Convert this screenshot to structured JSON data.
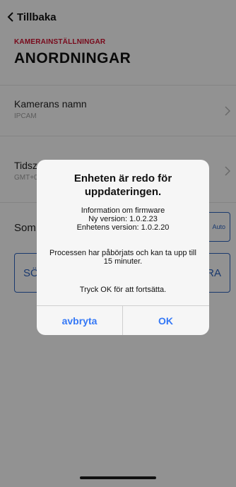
{
  "nav": {
    "back_label": "Tillbaka"
  },
  "header": {
    "subtitle": "KAMERAINSTÄLLNINGAR",
    "title": "ANORDNINGAR"
  },
  "settings": {
    "camera_name": {
      "label": "Kamerans namn",
      "value": "IPCAM"
    },
    "timezone": {
      "label": "Tidszon",
      "value": "GMT+01:00"
    },
    "row3": {
      "label": "Som",
      "button": "Auto"
    },
    "left_button": "SÖK",
    "right_button": "RA"
  },
  "dialog": {
    "title": "Enheten är redo för uppdateringen.",
    "info_heading": "Information om firmware",
    "new_version": "Ny version: 1.0.2.23",
    "device_version": "Enhetens version: 1.0.2.20",
    "process_text": "Processen har påbörjats och kan ta upp till 15 minuter.",
    "continue_text": "Tryck OK för att fortsätta.",
    "cancel_label": "avbryta",
    "ok_label": "OK"
  },
  "colors": {
    "accent_red": "#c8102e",
    "accent_blue": "#2b5fb8",
    "dialog_button_blue": "#3478f6"
  }
}
